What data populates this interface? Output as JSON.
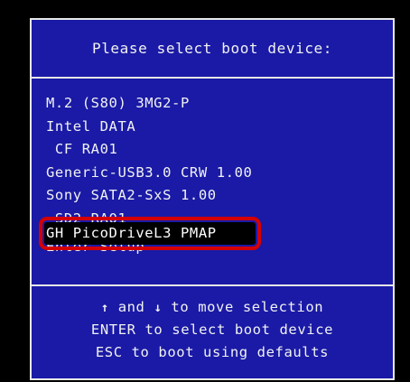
{
  "title": "Please select boot device:",
  "devices": [
    {
      "label": "M.2 (S80) 3MG2-P"
    },
    {
      "label": "Intel DATA"
    },
    {
      "label": " CF RA01"
    },
    {
      "label": "Generic-USB3.0 CRW 1.00"
    },
    {
      "label": "Sony SATA2-SxS 1.00"
    },
    {
      "label": " SD2 RA01"
    },
    {
      "label": "GH PicoDriveL3 PMAP",
      "selected": true
    },
    {
      "label": "Enter Setup"
    }
  ],
  "help": {
    "line1_up_arrow": "↑",
    "line1_and": " and ",
    "line1_down_arrow": "↓",
    "line1_rest": " to move selection",
    "line2": "ENTER to select boot device",
    "line3": "ESC to boot using defaults"
  },
  "colors": {
    "panel_background": "#1a1aa6",
    "text": "#f2f2f2",
    "highlight_outline": "#d40000",
    "selected_background": "#000000"
  }
}
